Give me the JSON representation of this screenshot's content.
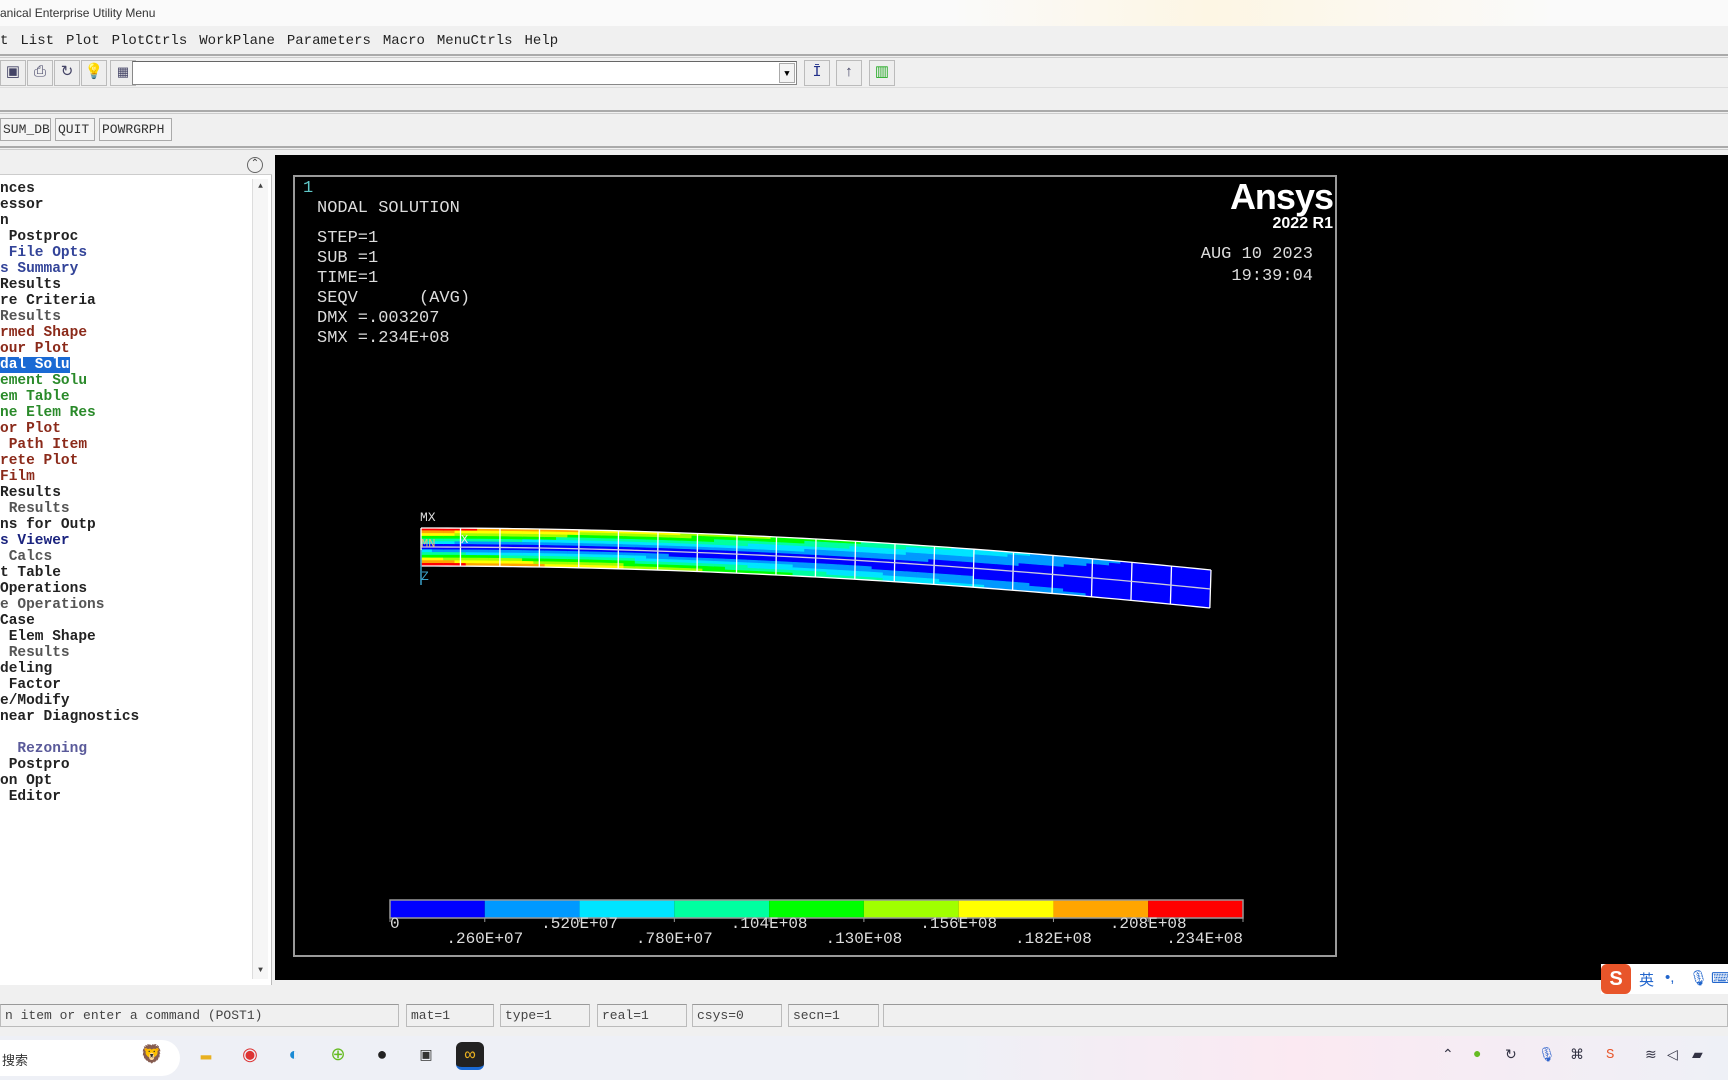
{
  "window": {
    "title": "anical Enterprise Utility Menu"
  },
  "menu": [
    "t",
    "List",
    "Plot",
    "PlotCtrls",
    "WorkPlane",
    "Parameters",
    "Macro",
    "MenuCtrls",
    "Help"
  ],
  "toolbar": {
    "icons": [
      "new-analysis-icon",
      "print-icon",
      "save-icon",
      "help-bulb-icon"
    ],
    "command_value": "",
    "right_icons": [
      "raise-hidden-icon",
      "reset-picking-icon",
      "contact-manager-icon"
    ]
  },
  "abbrev_buttons": [
    "SUM_DB",
    "QUIT",
    "POWRGRPH"
  ],
  "tree": {
    "items": [
      {
        "label": "nces",
        "color": "black"
      },
      {
        "label": "essor",
        "color": "black"
      },
      {
        "label": "n",
        "color": "black"
      },
      {
        "label": " Postproc",
        "color": "black"
      },
      {
        "label": " File Opts",
        "color": "blue"
      },
      {
        "label": "s Summary",
        "color": "blue"
      },
      {
        "label": "Results",
        "color": "black"
      },
      {
        "label": "re Criteria",
        "color": "black"
      },
      {
        "label": "Results",
        "color": "grey"
      },
      {
        "label": "rmed Shape",
        "color": "brown"
      },
      {
        "label": "our Plot",
        "color": "brown"
      },
      {
        "label": "dal Solu",
        "color": "selected"
      },
      {
        "label": "ement Solu",
        "color": "green"
      },
      {
        "label": "em Table",
        "color": "green"
      },
      {
        "label": "ne Elem Res",
        "color": "green"
      },
      {
        "label": "or Plot",
        "color": "brown"
      },
      {
        "label": " Path Item",
        "color": "brown"
      },
      {
        "label": "rete Plot",
        "color": "brown"
      },
      {
        "label": "Film",
        "color": "brown"
      },
      {
        "label": "Results",
        "color": "black"
      },
      {
        "label": " Results",
        "color": "grey"
      },
      {
        "label": "ns for Outp",
        "color": "black"
      },
      {
        "label": "s Viewer",
        "color": "navy"
      },
      {
        "label": " Calcs",
        "color": "grey"
      },
      {
        "label": "t Table",
        "color": "black"
      },
      {
        "label": "Operations",
        "color": "black"
      },
      {
        "label": "e Operations",
        "color": "grey"
      },
      {
        "label": "Case",
        "color": "black"
      },
      {
        "label": " Elem Shape",
        "color": "black"
      },
      {
        "label": " Results",
        "color": "grey"
      },
      {
        "label": "deling",
        "color": "black"
      },
      {
        "label": " Factor",
        "color": "black"
      },
      {
        "label": "e/Modify",
        "color": "black"
      },
      {
        "label": "near Diagnostics",
        "color": "black"
      },
      {
        "label": "",
        "color": "black"
      },
      {
        "label": "  Rezoning",
        "color": "lav"
      },
      {
        "label": " Postpro",
        "color": "black"
      },
      {
        "label": "on Opt",
        "color": "black"
      },
      {
        "label": " Editor",
        "color": "black"
      }
    ]
  },
  "plot": {
    "window_number": "1",
    "title": "NODAL SOLUTION",
    "info": [
      "STEP=1",
      "SUB =1",
      "TIME=1",
      "SEQV      (AVG)",
      "DMX =.003207",
      "SMX =.234E+08"
    ],
    "logo": {
      "name": "Ansys",
      "version": "2022 R1"
    },
    "date": "AUG 10 2023",
    "time": "19:39:04",
    "mx_label": "MX",
    "mn_label": "MN",
    "axis_x": "X",
    "axis_z": "Z",
    "legend": {
      "colors": [
        "#0000ff",
        "#0099ff",
        "#00e5ff",
        "#00ffa0",
        "#00ff00",
        "#a0ff00",
        "#ffff00",
        "#ffa500",
        "#ff0000"
      ],
      "labels": [
        "0",
        ".260E+07",
        ".520E+07",
        ".780E+07",
        ".104E+08",
        ".130E+08",
        ".156E+08",
        ".182E+08",
        ".208E+08",
        ".234E+08"
      ],
      "min": 0,
      "max": 23400000
    }
  },
  "status": {
    "prompt": "n item or enter a command (POST1)",
    "fields": [
      "mat=1",
      "type=1",
      "real=1",
      "csys=0",
      "secn=1",
      ""
    ]
  },
  "taskbar": {
    "search": "搜索",
    "apps": [
      "lion-widget-icon",
      "file-explorer-icon",
      "chrome-icon",
      "edge-icon",
      "green-app-icon",
      "app-notification-icon",
      "terminal-icon",
      "ansys-icon"
    ],
    "tray": [
      "chevron-up-icon",
      "green-tray-icon",
      "sync-icon",
      "microphone-icon",
      "network-icon",
      "sogou-icon",
      "wifi-icon",
      "volume-icon",
      "battery-icon"
    ]
  },
  "ime": {
    "lang": "英",
    "punct": "•,"
  }
}
